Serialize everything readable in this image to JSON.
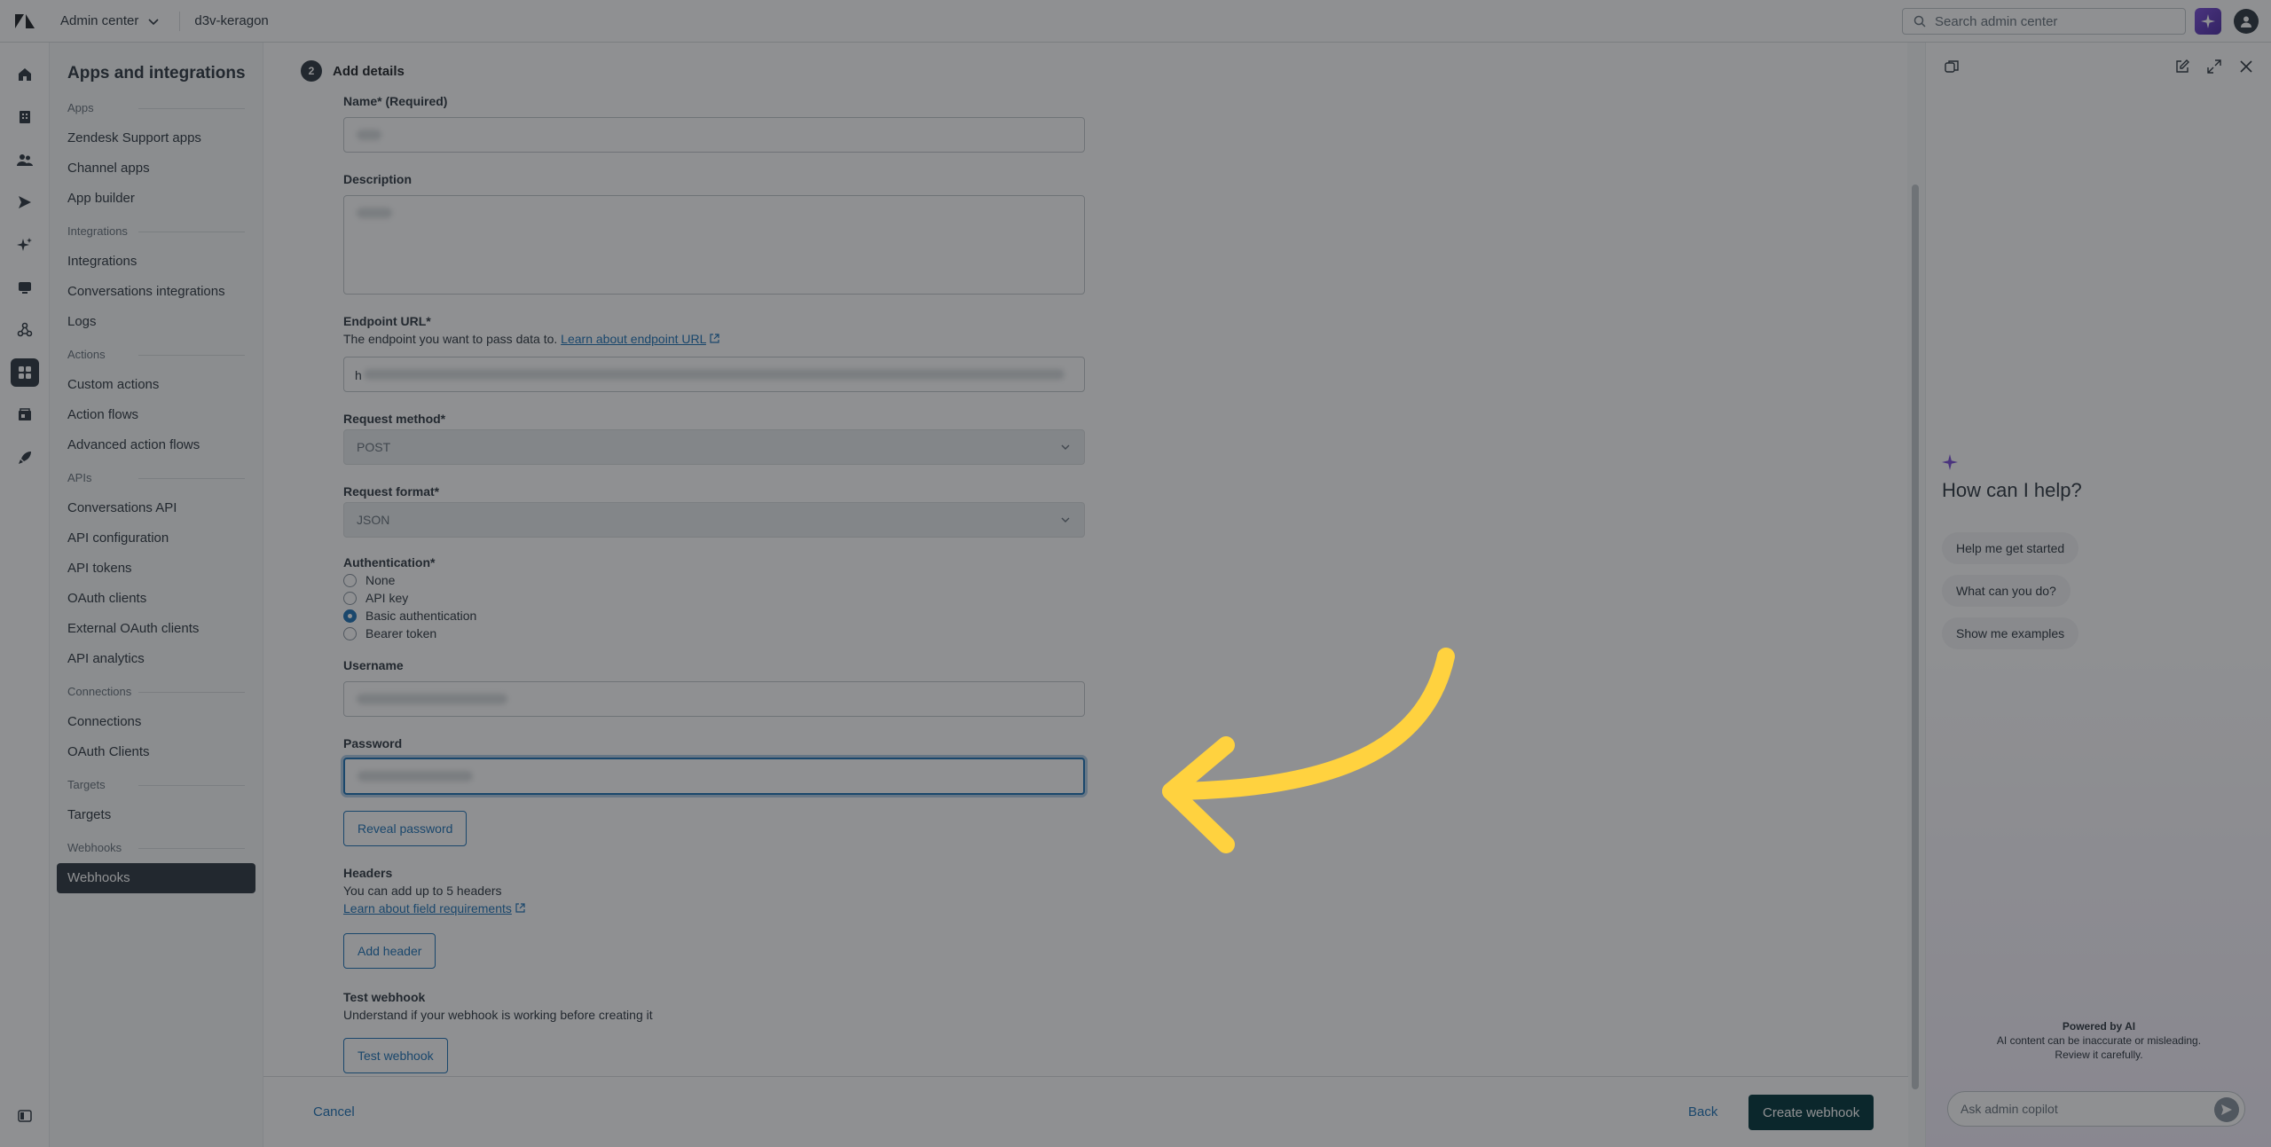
{
  "topbar": {
    "product": "Admin center",
    "account": "d3v-keragon",
    "search_placeholder": "Search admin center",
    "logo_icon": "zendesk-logo",
    "copilot_icon": "sparkle-icon",
    "avatar_icon": "user-icon"
  },
  "rail": {
    "icons": [
      "home-icon",
      "building-icon",
      "people-icon",
      "channels-icon",
      "ai-sparkle-icon",
      "workspaces-icon",
      "objects-icon",
      "apps-icon",
      "account-icon",
      "rocket-icon",
      "collapse-icon"
    ]
  },
  "nav": {
    "title": "Apps and integrations",
    "groups": [
      {
        "title": "Apps",
        "items": [
          "Zendesk Support apps",
          "Channel apps",
          "App builder"
        ]
      },
      {
        "title": "Integrations",
        "items": [
          "Integrations",
          "Conversations integrations",
          "Logs"
        ]
      },
      {
        "title": "Actions",
        "items": [
          "Custom actions",
          "Action flows",
          "Advanced action flows"
        ]
      },
      {
        "title": "APIs",
        "items": [
          "Conversations API",
          "API configuration",
          "API tokens",
          "OAuth clients",
          "External OAuth clients",
          "API analytics"
        ]
      },
      {
        "title": "Connections",
        "items": [
          "Connections",
          "OAuth Clients"
        ]
      },
      {
        "title": "Targets",
        "items": [
          "Targets"
        ]
      },
      {
        "title": "Webhooks",
        "items": [
          "Webhooks"
        ]
      }
    ],
    "active": "Webhooks"
  },
  "form": {
    "step_number": "2",
    "step_title": "Add details",
    "name_label": "Name* (Required)",
    "description_label": "Description",
    "endpoint_label": "Endpoint URL*",
    "endpoint_hint": "The endpoint you want to pass data to.",
    "endpoint_link": "Learn about endpoint URL",
    "endpoint_prefix": "h",
    "method_label": "Request method*",
    "method_value": "POST",
    "format_label": "Request format*",
    "format_value": "JSON",
    "auth_label": "Authentication*",
    "auth_options": [
      "None",
      "API key",
      "Basic authentication",
      "Bearer token"
    ],
    "auth_selected": "Basic authentication",
    "username_label": "Username",
    "password_label": "Password",
    "reveal_password": "Reveal password",
    "headers_label": "Headers",
    "headers_hint": "You can add up to 5 headers",
    "headers_link": "Learn about field requirements",
    "add_header": "Add header",
    "test_label": "Test webhook",
    "test_hint": "Understand if your webhook is working before creating it",
    "test_button": "Test webhook"
  },
  "footer": {
    "cancel": "Cancel",
    "back": "Back",
    "create": "Create webhook"
  },
  "copilot": {
    "title": "How can I help?",
    "chips": [
      "Help me get started",
      "What can you do?",
      "Show me examples"
    ],
    "powered_by": "Powered by AI",
    "disclaimer_1": "AI content can be inaccurate or misleading.",
    "disclaimer_2": "Review it carefully.",
    "ask_placeholder": "Ask admin copilot"
  },
  "annotation": {
    "arrow_color": "#ffd23f",
    "target": "password-input"
  }
}
